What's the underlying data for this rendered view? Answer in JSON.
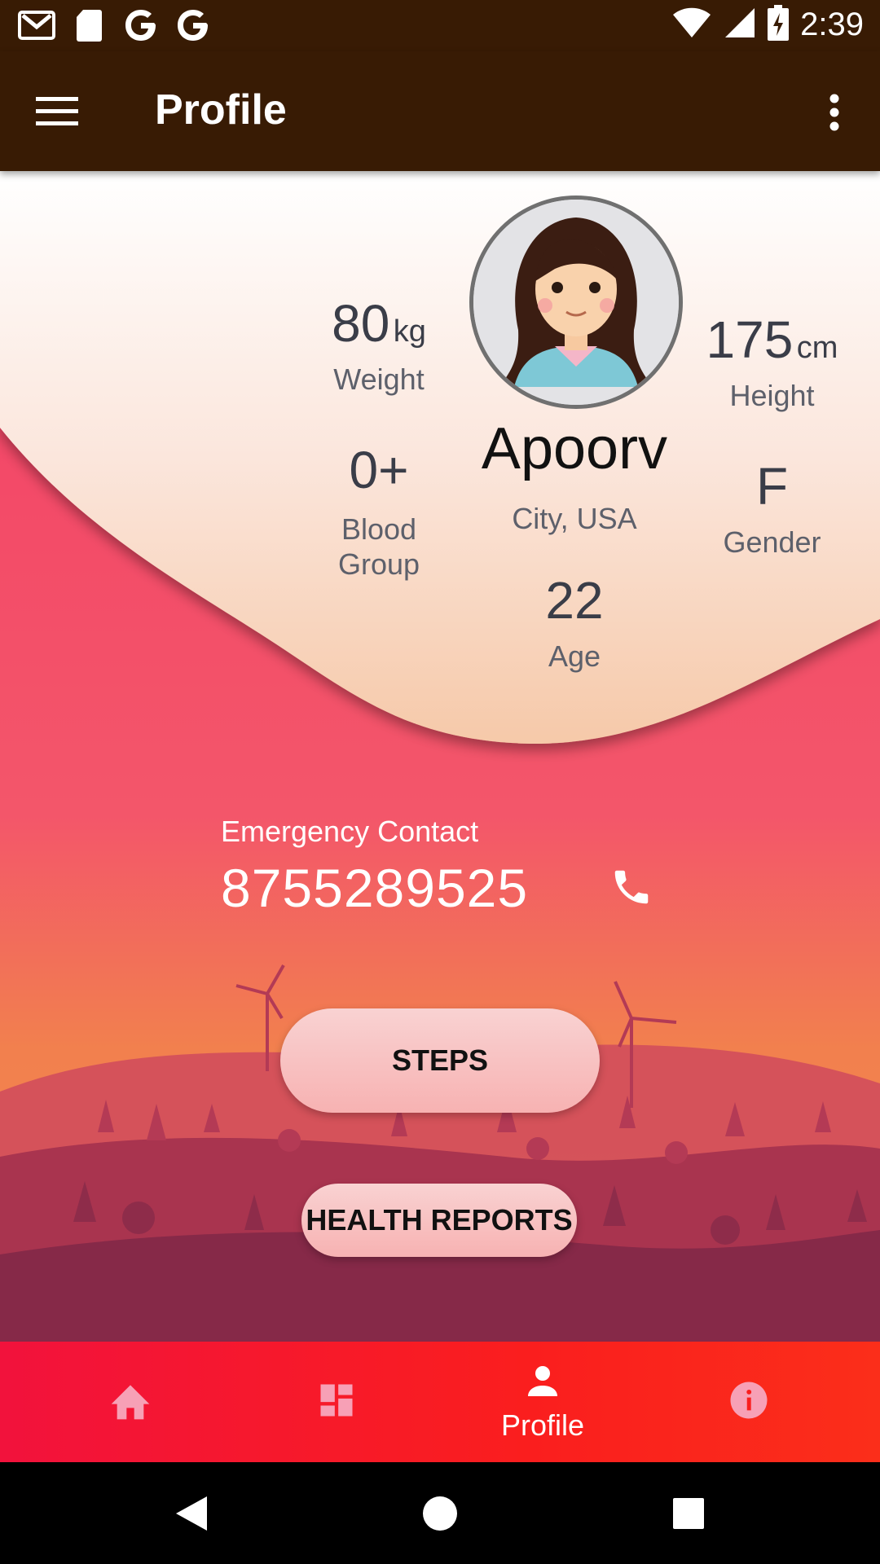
{
  "status_bar": {
    "time": "2:39",
    "left_icons": [
      "gmail-icon",
      "sd-card-icon",
      "google-icon",
      "google-icon"
    ],
    "right_icons": [
      "wifi-icon",
      "signal-icon",
      "battery-charging-icon"
    ]
  },
  "app_bar": {
    "title": "Profile",
    "menu_icon": "hamburger-menu-icon",
    "more_icon": "more-vertical-icon"
  },
  "profile": {
    "name": "Apoorv",
    "location": "City, USA",
    "weight": {
      "value": "80",
      "unit": "kg",
      "label": "Weight"
    },
    "height": {
      "value": "175",
      "unit": "cm",
      "label": "Height"
    },
    "blood_group": {
      "value": "0+",
      "label_line1": "Blood",
      "label_line2": "Group"
    },
    "gender": {
      "value": "F",
      "label": "Gender"
    },
    "age": {
      "value": "22",
      "label": "Age"
    }
  },
  "emergency": {
    "label": "Emergency Contact",
    "number": "8755289525",
    "icon": "phone-icon"
  },
  "buttons": {
    "steps": "STEPS",
    "health_reports": "HEALTH REPORTS"
  },
  "bottom_nav": {
    "items": [
      {
        "icon": "home-icon",
        "label": ""
      },
      {
        "icon": "dashboard-icon",
        "label": ""
      },
      {
        "icon": "person-icon",
        "label": "Profile",
        "active": true
      },
      {
        "icon": "info-icon",
        "label": ""
      }
    ]
  },
  "colors": {
    "app_bar": "#381b04",
    "accent_pink": "#f23c62",
    "nav_red": "#fa1e1e"
  }
}
